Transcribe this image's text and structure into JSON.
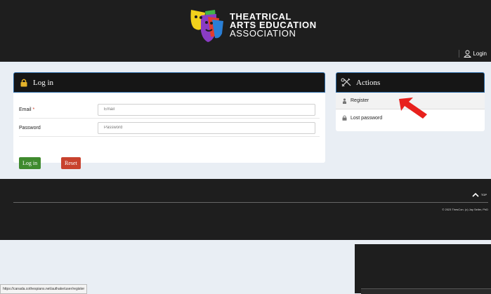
{
  "header": {
    "logo_line1": "THEATRICAL",
    "logo_line2": "ARTS EDUCATION",
    "logo_line3": "ASSOCIATION",
    "login_label": "Login"
  },
  "login_panel": {
    "title": "Log in",
    "email_label": "Email",
    "email_required_mark": "*",
    "email_placeholder": "Email",
    "password_label": "Password",
    "password_placeholder": "Password",
    "login_button": "Log in",
    "reset_button": "Reset"
  },
  "actions_panel": {
    "title": "Actions",
    "items": [
      {
        "label": "Register",
        "icon": "person-icon"
      },
      {
        "label": "Lost password",
        "icon": "lock-icon"
      }
    ]
  },
  "footer": {
    "top_label": "TOP",
    "copyright": "© 2023 ThesCon. (c) Jay Seller, PhD"
  },
  "status_bar": {
    "url": "https://canada.cothespians.net/authake/user/register"
  },
  "colors": {
    "accent_blue": "#2b6aa5",
    "login_button": "#3f8a2e",
    "reset_button": "#c8422e",
    "arrow": "#e8211d",
    "header_bg": "#1e1e1e"
  }
}
